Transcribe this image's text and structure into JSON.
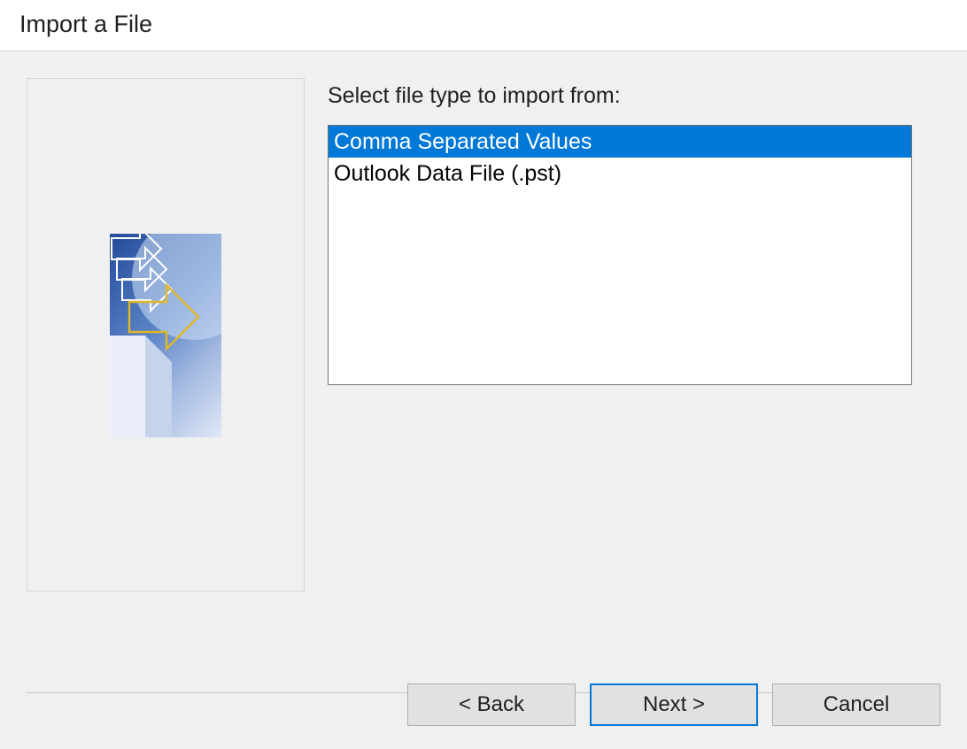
{
  "window": {
    "title": "Import a File"
  },
  "main": {
    "prompt": "Select file type to import from:",
    "options": [
      {
        "label": "Comma Separated Values",
        "selected": true
      },
      {
        "label": "Outlook Data File (.pst)",
        "selected": false
      }
    ]
  },
  "buttons": {
    "back": "< Back",
    "next": "Next >",
    "cancel": "Cancel"
  },
  "colors": {
    "selection": "#0078d7",
    "dialogBg": "#f0f0f0",
    "buttonBg": "#e1e1e1"
  }
}
